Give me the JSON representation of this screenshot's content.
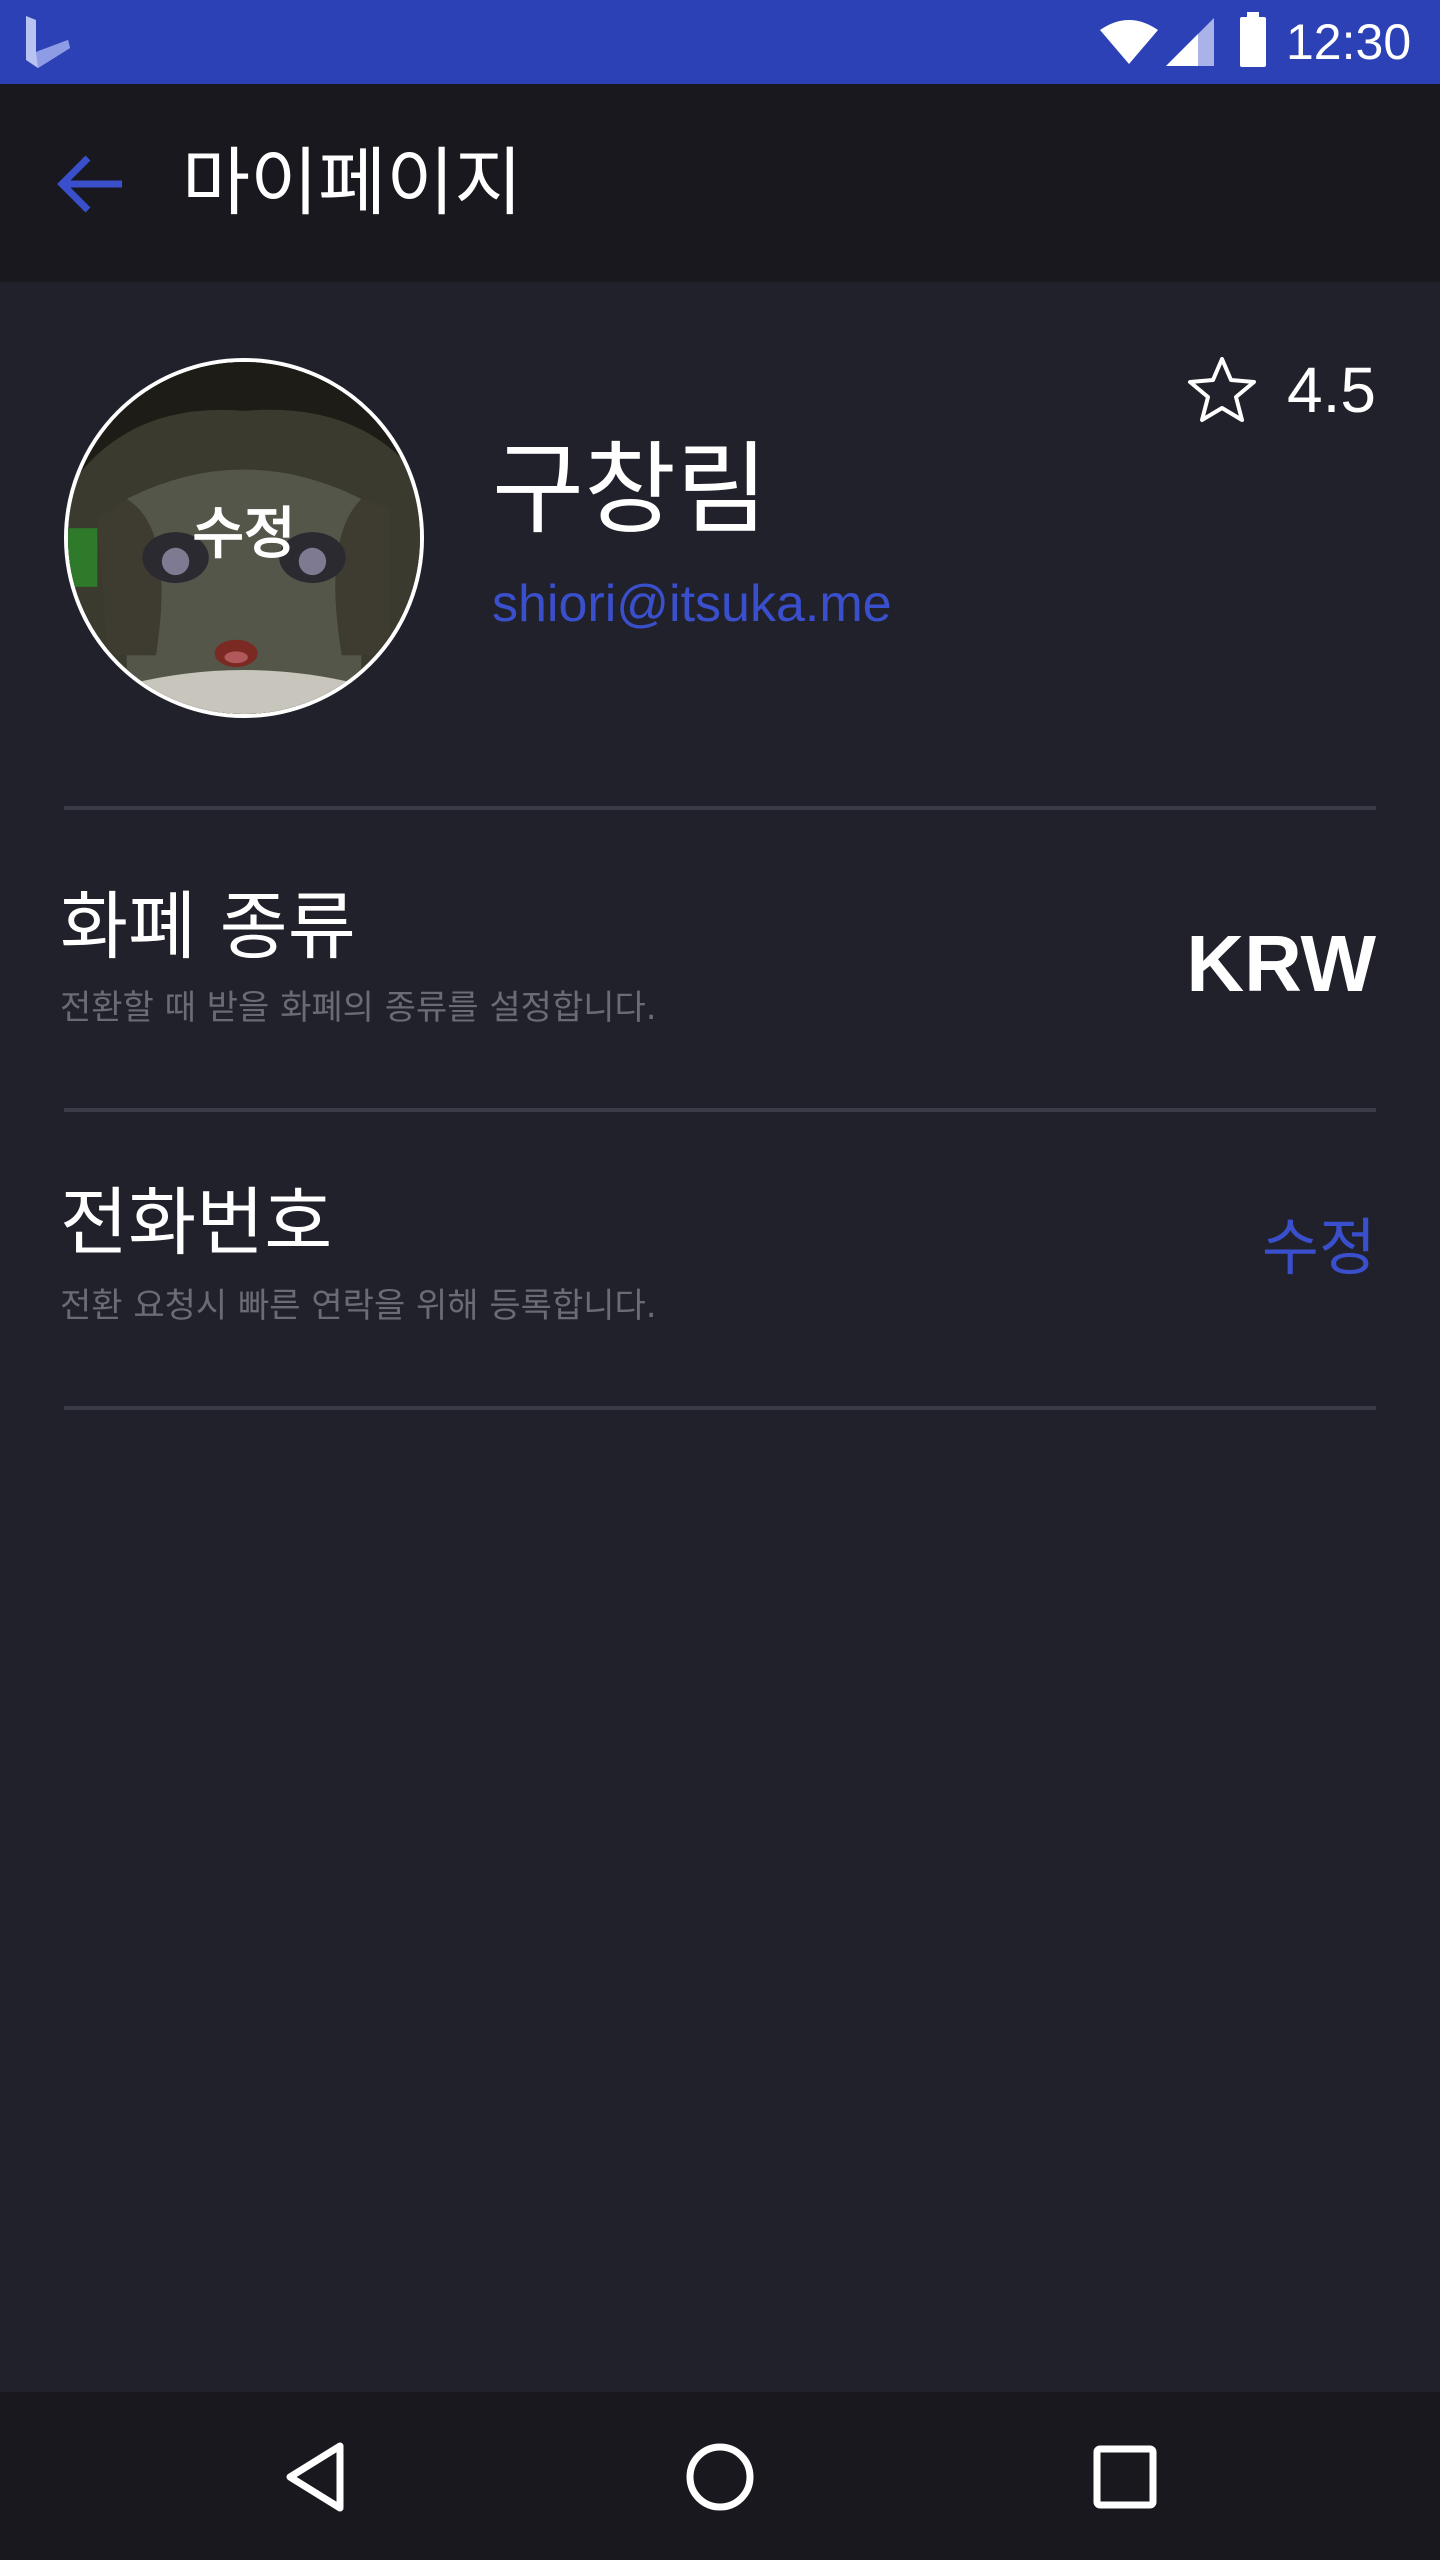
{
  "status_bar": {
    "time": "12:30",
    "icons": [
      "app-logo-icon",
      "wifi-icon",
      "signal-icon",
      "battery-icon"
    ]
  },
  "app_bar": {
    "title": "마이페이지",
    "back_icon": "arrow-left-icon"
  },
  "profile": {
    "avatar_edit_label": "수정",
    "name": "구창림",
    "email": "shiori@itsuka.me",
    "rating": "4.5",
    "rating_icon": "star-outline-icon"
  },
  "settings": [
    {
      "title": "화폐 종류",
      "description": "전환할 때 받을 화폐의 종류를 설정합니다.",
      "value": "KRW"
    },
    {
      "title": "전화번호",
      "description": "전환 요청시 빠른 연락을 위해 등록합니다.",
      "action_label": "수정"
    }
  ],
  "nav_bar": {
    "icons": [
      "back-triangle-icon",
      "home-circle-icon",
      "recents-square-icon"
    ]
  },
  "colors": {
    "status_bar": "#2c41b6",
    "app_bar": "#18181e",
    "background": "#21212b",
    "accent": "#3a4fcc",
    "divider": "#3b3b47",
    "muted_text": "#6b6b75"
  }
}
